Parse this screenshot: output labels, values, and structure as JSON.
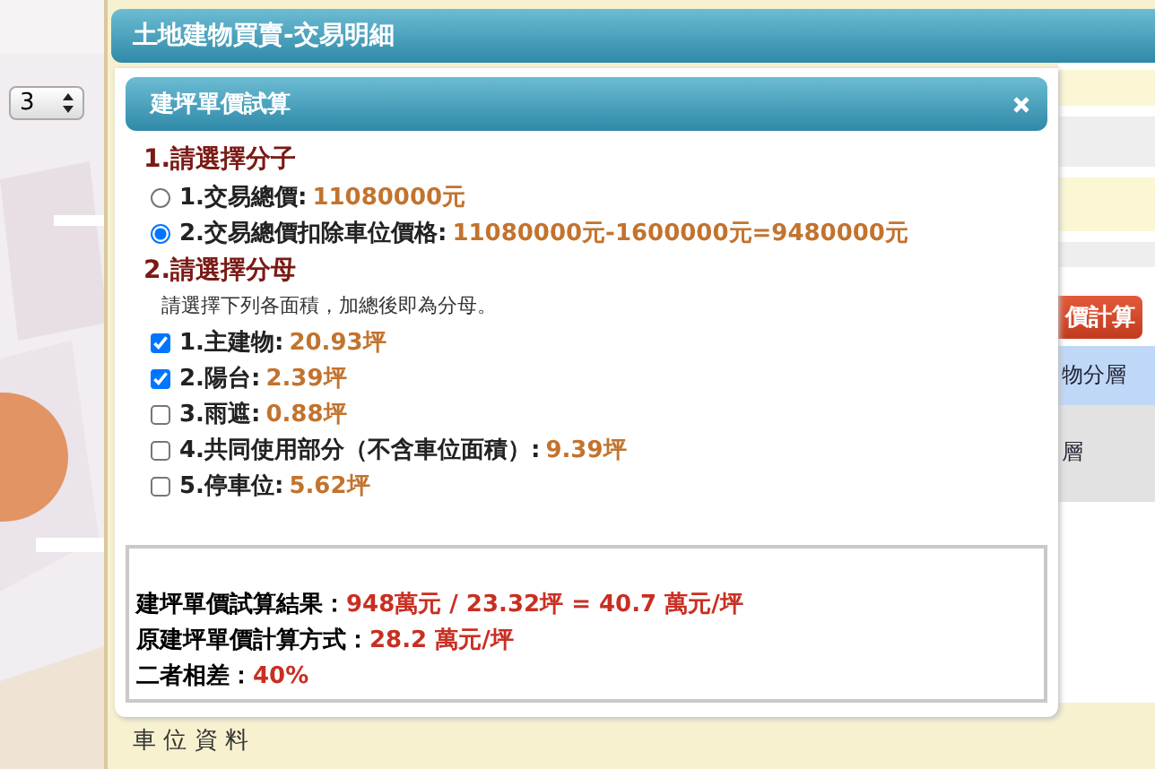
{
  "map": {
    "kind": "picture",
    "floor_select": {
      "value": "3"
    }
  },
  "window": {
    "title": "土地建物買賣-交易明細"
  },
  "background": {
    "calc_button": "價計算",
    "cells": [
      {
        "text": "物分層",
        "kind": "header"
      },
      {
        "text": "層",
        "kind": "body"
      }
    ],
    "section_title": "車 位 資 料"
  },
  "dialog": {
    "title": "建坪單價試算",
    "numerator": {
      "heading": "1.請選擇分子",
      "options": [
        {
          "label": "1.交易總價:",
          "value": "11080000元",
          "selected": false
        },
        {
          "label": "2.交易總價扣除車位價格:",
          "value": "11080000元-1600000元=9480000元",
          "selected": true
        }
      ]
    },
    "denominator": {
      "heading": "2.請選擇分母",
      "hint": "請選擇下列各面積，加總後即為分母。",
      "items": [
        {
          "label": "1.主建物:",
          "value": "20.93坪",
          "checked": true
        },
        {
          "label": "2.陽台:",
          "value": "2.39坪",
          "checked": true
        },
        {
          "label": "3.雨遮:",
          "value": "0.88坪",
          "checked": false
        },
        {
          "label": "4.共同使用部分（不含車位面積）:",
          "value": "9.39坪",
          "checked": false
        },
        {
          "label": "5.停車位:",
          "value": "5.62坪",
          "checked": false
        }
      ]
    },
    "results": [
      {
        "label": "建坪單價試算結果：",
        "value": "948萬元 / 23.32坪 = 40.7 萬元/坪"
      },
      {
        "label": "原建坪單價計算方式：",
        "value": "28.2 萬元/坪"
      },
      {
        "label": "二者相差：",
        "value": "40%"
      }
    ]
  }
}
